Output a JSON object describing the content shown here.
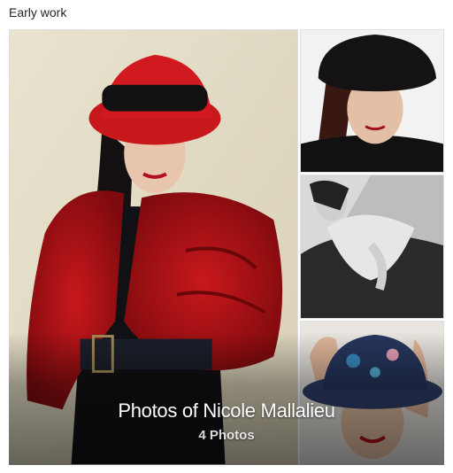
{
  "section": {
    "title": "Early work"
  },
  "album": {
    "title": "Photos of Nicole Mallalieu",
    "count_label": "4 Photos"
  },
  "photos": [
    {
      "name": "woman-red-hat-red-coat"
    },
    {
      "name": "woman-black-fur-hat"
    },
    {
      "name": "woman-black-white-lying"
    },
    {
      "name": "woman-blue-hat-smiling"
    }
  ]
}
